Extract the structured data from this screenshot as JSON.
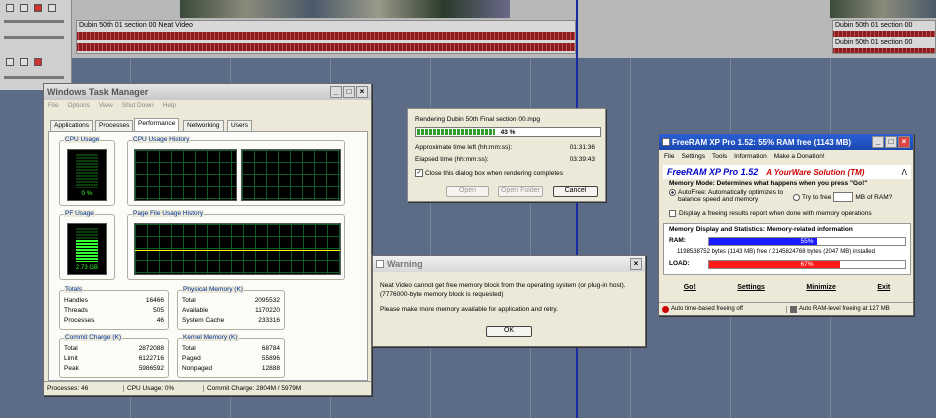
{
  "editor": {
    "clip1_label": "Dubin 50th 01 section 00 Neat Video",
    "clip2_label": "Dubin 50th 01 section 00",
    "clip2_sub": "Dubin 50th 01 section 00"
  },
  "task_manager": {
    "title": "Windows Task Manager",
    "menu": [
      "File",
      "Options",
      "View",
      "Shut Down",
      "Help"
    ],
    "tabs": [
      "Applications",
      "Processes",
      "Performance",
      "Networking",
      "Users"
    ],
    "cpu_usage_title": "CPU Usage",
    "cpu_usage_value": "0 %",
    "cpu_history_title": "CPU Usage History",
    "pf_usage_title": "PF Usage",
    "pf_usage_value": "2.73 GB",
    "pf_history_title": "Page File Usage History",
    "totals": {
      "title": "Totals",
      "rows": [
        [
          "Handles",
          "16466"
        ],
        [
          "Threads",
          "505"
        ],
        [
          "Processes",
          "46"
        ]
      ]
    },
    "physical": {
      "title": "Physical Memory (K)",
      "rows": [
        [
          "Total",
          "2095532"
        ],
        [
          "Available",
          "1170220"
        ],
        [
          "System Cache",
          "233316"
        ]
      ]
    },
    "commit": {
      "title": "Commit Charge (K)",
      "rows": [
        [
          "Total",
          "2872088"
        ],
        [
          "Limit",
          "6122716"
        ],
        [
          "Peak",
          "5986592"
        ]
      ]
    },
    "kernel": {
      "title": "Kernel Memory (K)",
      "rows": [
        [
          "Total",
          "68784"
        ],
        [
          "Paged",
          "55896"
        ],
        [
          "Nonpaged",
          "12888"
        ]
      ]
    },
    "status": {
      "processes": "Processes: 46",
      "cpu": "CPU Usage: 0%",
      "commit": "Commit Charge: 2804M / 5979M"
    }
  },
  "render": {
    "title": "Rendering Dubin 50th Final section 00.mpg",
    "percent_label": "43 %",
    "progress": 0.43,
    "time_left_label": "Approximate time left (hh:mm:ss):",
    "time_left_value": "01:31:36",
    "elapsed_label": "Elapsed time (hh:mm:ss):",
    "elapsed_value": "03:39:43",
    "close_checkbox": "Close this dialog box when rendering completes",
    "open_btn": "Open",
    "open_folder_btn": "Open Folder",
    "cancel_btn": "Cancel"
  },
  "warning": {
    "title": "Warning",
    "message1": "Neat Video cannot get free memory block from the operating system (or plug-in host).",
    "message2": "(7776000-byte memory block is requested)",
    "message3": "Please make more memory available for application and retry.",
    "ok_btn": "OK"
  },
  "freeram": {
    "title": "FreeRAM XP Pro 1.52: 55% RAM free (1143 MB)",
    "menu": [
      "File",
      "Settings",
      "Tools",
      "Information",
      "Make a Donation!"
    ],
    "brand": "FreeRAM XP Pro 1.52",
    "tagline": "A YourWare Solution (TM)",
    "mode_label": "Memory Mode: Determines what happens when you press \"Go!\"",
    "autofree_label": "AutoFree: Automatically optimizes to balance speed and memory",
    "try_free_label": "Try to free",
    "mb_of_ram": "MB of RAM?",
    "display_report": "Display a freeing results report when done with memory operations",
    "stats_label": "Memory Display and Statistics: Memory-related information",
    "ram_label": "RAM:",
    "ram_percent": "55%",
    "ram_fraction": 0.55,
    "ram_detail": "1198538752 bytes (1143 MB) free / 2145824768 bytes (2047 MB) installed",
    "load_label": "LOAD:",
    "load_percent": "67%",
    "load_fraction": 0.67,
    "go_btn": "Go!",
    "settings_btn": "Settings",
    "minimize_btn": "Minimize",
    "exit_btn": "Exit",
    "status_left": "Auto time-based freeing off",
    "status_right": "Auto RAM-level freeing at 127 MB",
    "colors": {
      "ram_bar": "#1a1aff",
      "load_bar": "#ff1a1a",
      "brand": "#0000cc",
      "tagline": "#cc0000"
    }
  }
}
